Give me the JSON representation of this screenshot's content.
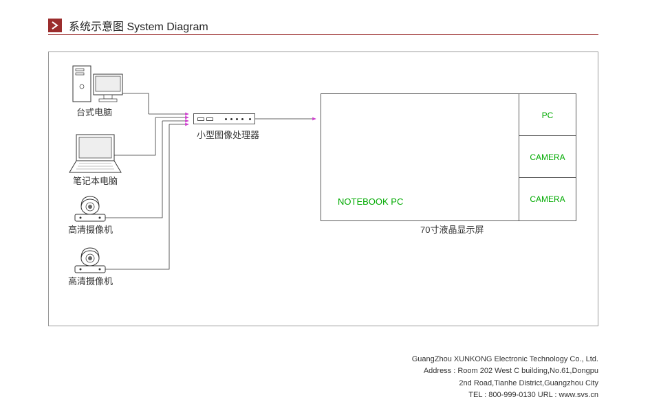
{
  "title": "系统示意图 System Diagram",
  "devices": {
    "desktop": "台式电脑",
    "notebook": "笔记本电脑",
    "camera1": "高清摄像机",
    "camera2": "高清摄像机"
  },
  "processor": "小型图像处理器",
  "display": {
    "main_label": "NOTEBOOK PC",
    "cell1": "PC",
    "cell2": "CAMERA",
    "cell3": "CAMERA",
    "caption": "70寸液晶显示屏"
  },
  "footer": {
    "company": "GuangZhou XUNKONG Electronic Technology Co., Ltd.",
    "address1": "Address : Room 202 West C building,No.61,Dongpu",
    "address2": "2nd Road,Tianhe District,Guangzhou City",
    "contact": "TEL : 800-999-0130      URL : www.svs.cn"
  },
  "colors": {
    "accent": "#9b2d2d",
    "green": "#00aa00",
    "magenta": "#d040d0"
  }
}
